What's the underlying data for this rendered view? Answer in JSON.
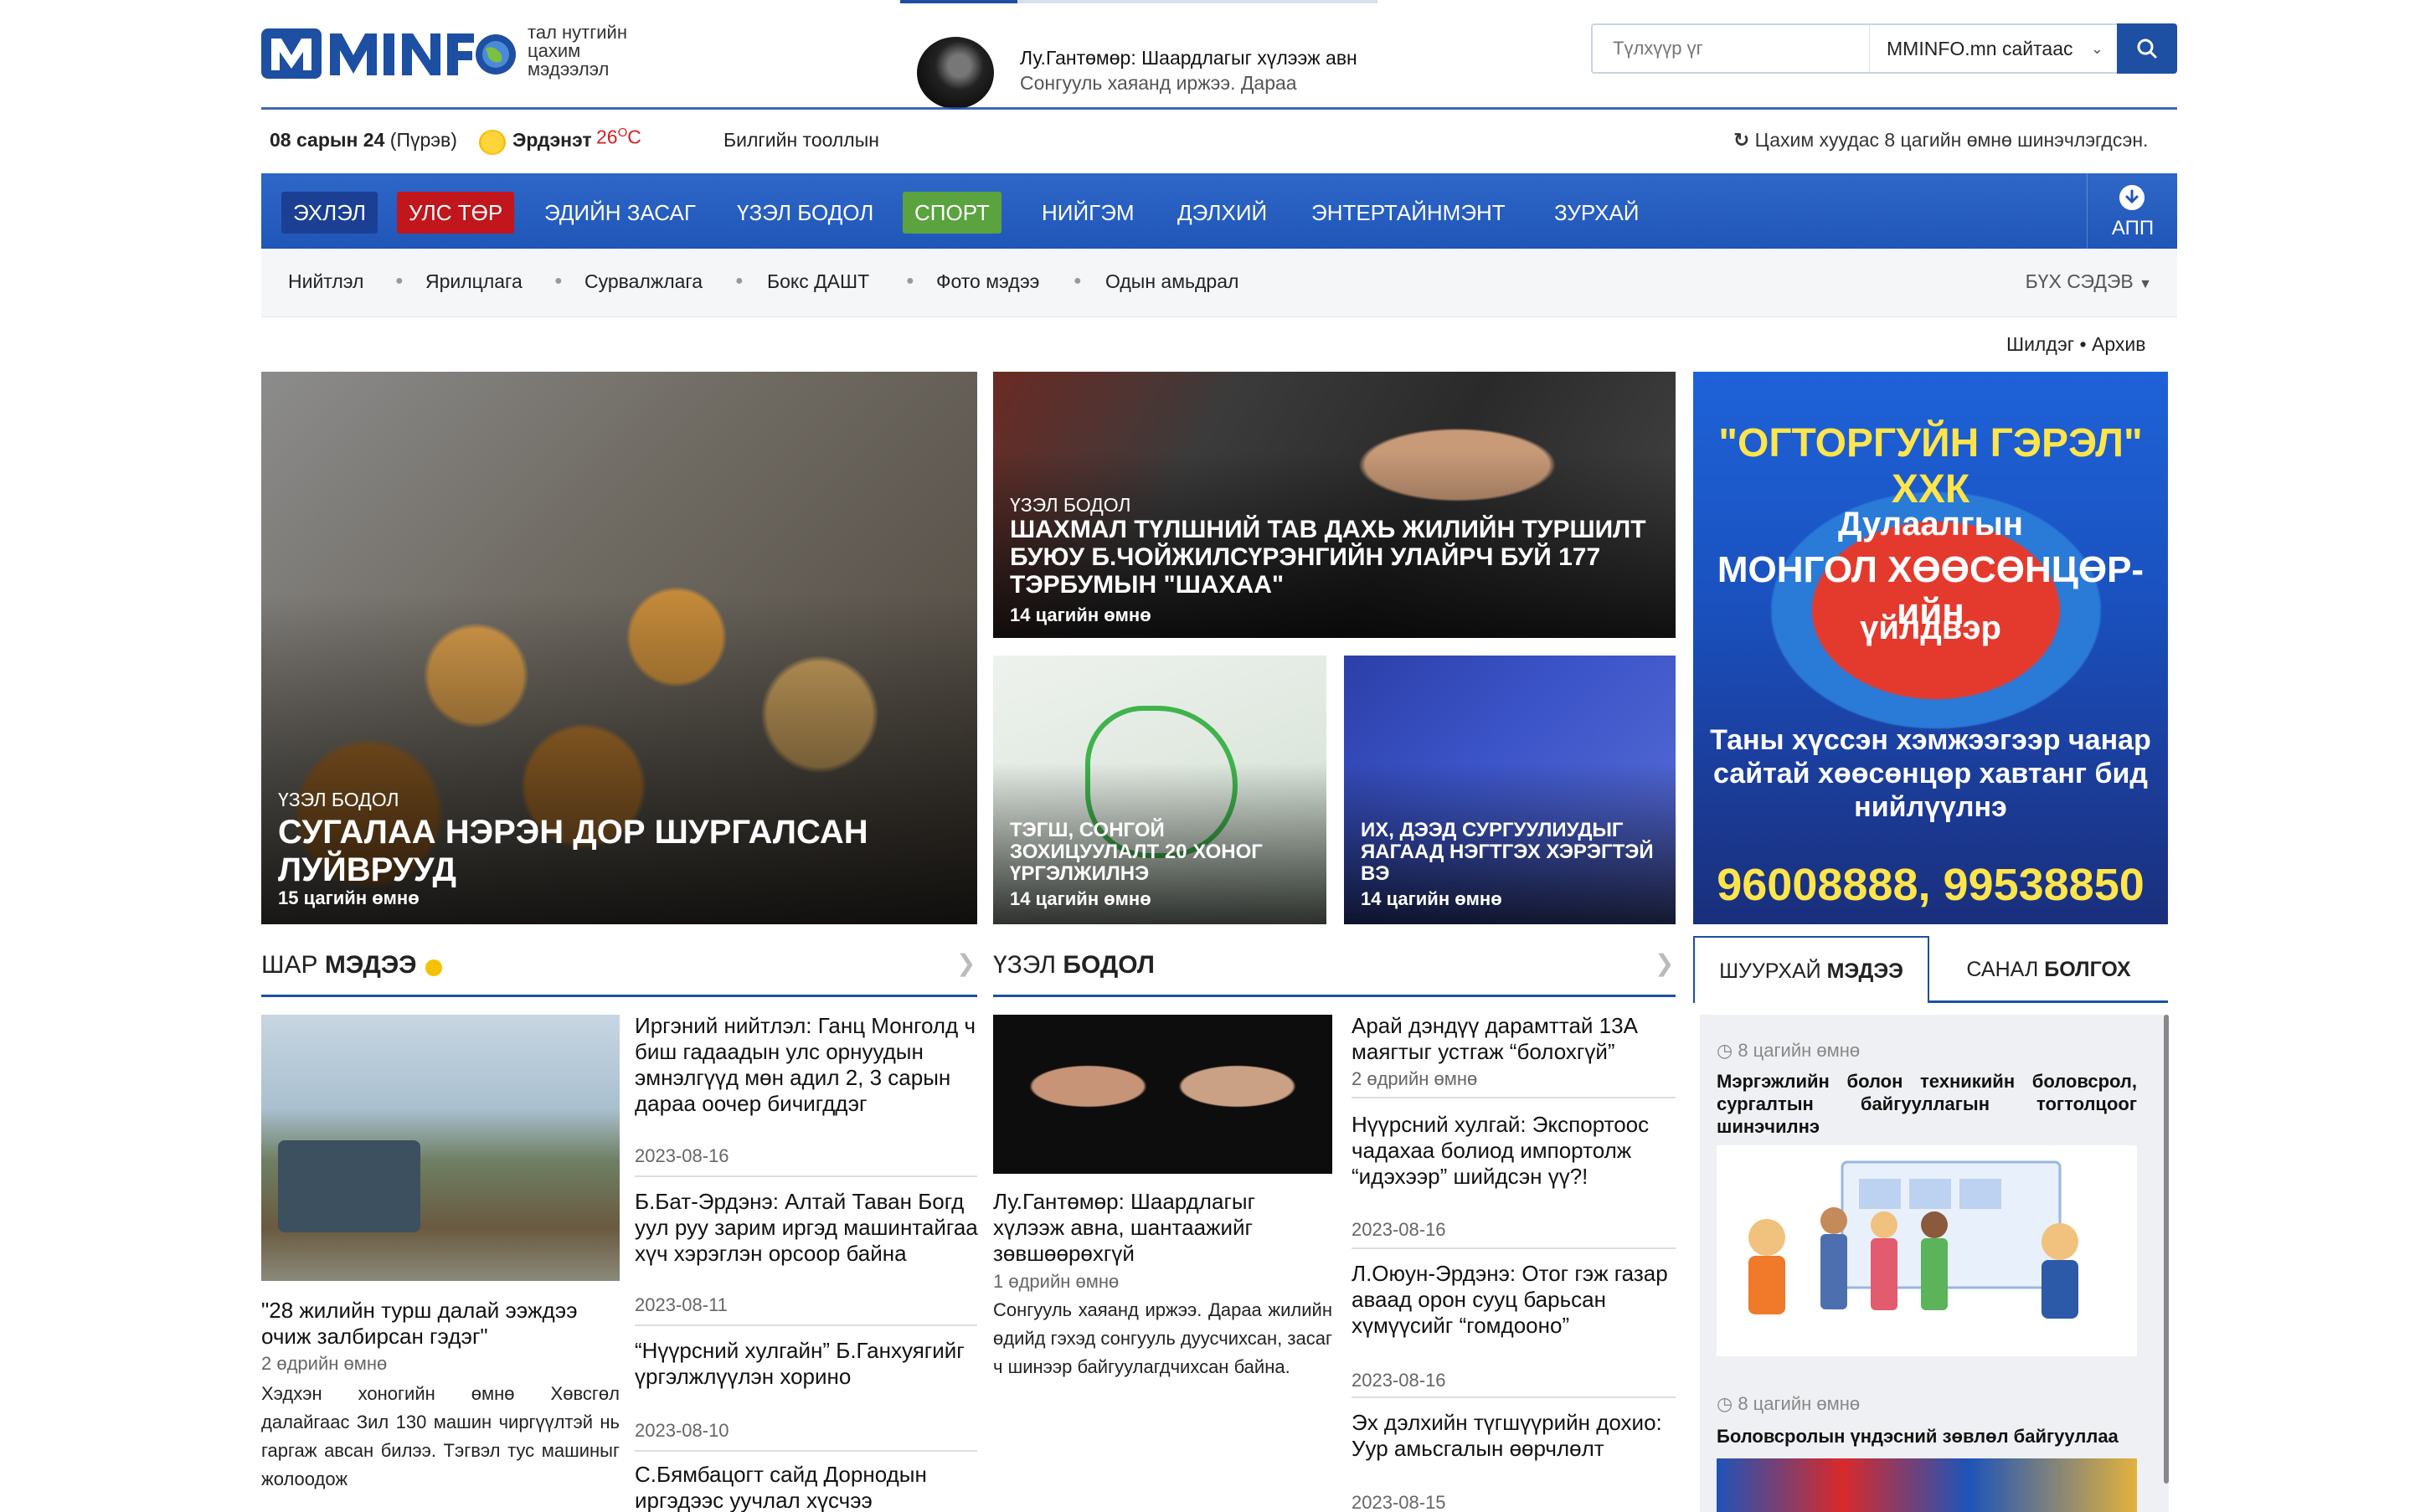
{
  "header": {
    "logo_text": "MMINFO",
    "logo_tagline": [
      "тал нутгийн",
      "цахим",
      "мэдээлэл"
    ],
    "ticker_title": "Лу.Гантөмөр: Шаардлагыг хүлээж авн",
    "ticker_sub": "Сонгууль хаяанд иржээ. Дараа",
    "search": {
      "placeholder": "Түлхүүр үг",
      "scope": "MMINFO.mn сайтаас"
    }
  },
  "infobar": {
    "date_bold": "08 сарын 24",
    "date_day": "(Пүрэв)",
    "weather_city": "Эрдэнэт",
    "weather_temp": "26",
    "weather_unit": "O",
    "weather_c": "C",
    "ticker2": "Билгийн тооллын",
    "updated": "Цахим хуудас 8 цагийн өмнө шинэчлэгдсэн."
  },
  "nav": {
    "items": [
      "ЭХЛЭЛ",
      "УЛС ТӨР",
      "ЭДИЙН ЗАСАГ",
      "ҮЗЭЛ БОДОЛ",
      "СПОРТ",
      "НИЙГЭМ",
      "ДЭЛХИЙ",
      "ЭНТЕРТАЙНМЭНТ",
      "ЗУРХАЙ"
    ],
    "app": "АПП"
  },
  "subnav": {
    "items": [
      "Нийтлэл",
      "Ярилцлага",
      "Сурвалжлага",
      "Бокс ДАШТ",
      "Фото мэдээ",
      "Одын амьдрал"
    ],
    "all": "БҮХ СЭДЭВ"
  },
  "links": {
    "shildeg": "Шилдэг",
    "archive": "Архив"
  },
  "hero": {
    "main": {
      "cat": "ҮЗЭЛ БОДОЛ",
      "title": "СУГАЛАА НЭРЭН ДОР ШУРГАЛСАН ЛУЙВРУУД",
      "ago": "15 цагийн өмнө"
    },
    "second": {
      "cat": "ҮЗЭЛ БОДОЛ",
      "title": "ШАХМАЛ ТҮЛШНИЙ ТАВ ДАХЬ ЖИЛИЙН ТУРШИЛТ БУЮУ Б.ЧОЙЖИЛСҮРЭНГИЙН УЛАЙРЧ БУЙ 177 ТЭРБУМЫН \"ШАХАА\"",
      "ago": "14 цагийн өмнө"
    },
    "third": {
      "title": "ТЭГШ, СОНГОЙ ЗОХИЦУУЛАЛТ 20 ХОНОГ ҮРГЭЛЖИЛНЭ",
      "ago": "14 цагийн өмнө"
    },
    "fourth": {
      "title": "ИХ, ДЭЭД СУРГУУЛИУДЫГ ЯАГААД НЭГТГЭХ ХЭРЭГТЭЙ ВЭ",
      "ago": "14 цагийн өмнө"
    }
  },
  "ad": {
    "l1": "\"ОГТОРГУЙН ГЭРЭЛ\" ХХК",
    "l2": "Дулаалгын",
    "l3": "МОНГОЛ ХӨӨСӨНЦӨР-ийн",
    "l4": "үйлдвэр",
    "l5": "Таны хүссэн хэмжээгээр чанар сайтай хөөсөнцөр хавтанг бид нийлүүлнэ",
    "l6": "96008888, 99538850"
  },
  "shar": {
    "h1": "ШАР",
    "h2": "МЭДЭЭ",
    "main_title": "\"28 жилийн турш далай ээждээ очиж залбирсан гэдэг\"",
    "main_date": "2 өдрийн өмнө",
    "main_lead": "Хэдхэн хоногийн өмнө Хөвсгөл далайгаас Зил 130 машин чиргүүлтэй нь гаргаж авсан билээ. Тэгвэл тус машиныг жолоодож",
    "list": [
      {
        "title": "Иргэний нийтлэл: Ганц Монголд ч биш гадаадын улс орнуудын эмнэлгүүд мөн адил 2, 3 сарын дараа оочер бичигддэг",
        "date": "2023-08-16"
      },
      {
        "title": "Б.Бат-Эрдэнэ: Алтай Таван Богд уул руу зарим иргэд машинтайгаа хүч хэрэглэн орсоор байна",
        "date": "2023-08-11"
      },
      {
        "title": "“Нүүрсний хулгайн” Б.Ганхуягийг үргэлжлүүлэн хорино",
        "date": "2023-08-10"
      },
      {
        "title": "С.Бямбацогт сайд Дорнодын иргэдээс уучлал хүсчээ",
        "date": ""
      }
    ]
  },
  "uzel": {
    "h1": "ҮЗЭЛ",
    "h2": "БОДОЛ",
    "main_title": "Лу.Гантөмөр: Шаардлагыг хүлээж авна, шантаажийг зөвшөөрөхгүй",
    "main_date": "1 өдрийн өмнө",
    "main_lead": "Сонгууль хаяанд иржээ. Дараа жилийн өдийд гэхэд сонгууль дуусчихсан, засаг ч шинээр байгуулагдчихсан байна.",
    "list": [
      {
        "title": "Арай дэндүү дарамттай 13А маягтыг устгаж “болохгүй”",
        "date": "2 өдрийн өмнө"
      },
      {
        "title": "Нүүрсний хулгай: Экспортоос чадахаа болиод импортолж “идэхээр” шийдсэн үү?!",
        "date": "2023-08-16"
      },
      {
        "title": "Л.Оюун-Эрдэнэ: Отог гэж газар аваад орон сууц барьсан хүмүүсийг “гомдооно”",
        "date": "2023-08-16"
      },
      {
        "title": "Эх дэлхийн түгшүүрийн дохио: Уур амьсгалын өөрчлөлт",
        "date": "2023-08-15"
      }
    ]
  },
  "tabs": {
    "a1": "ШУУРХАЙ",
    "a2": "МЭДЭЭ",
    "b1": "САНАЛ",
    "b2": "БОЛГОХ"
  },
  "feed": [
    {
      "time": "8 цагийн өмнө",
      "title": "Мэргэжлийн болон техникийн боловсрол, сургалтын байгууллагын тогтолцоог шинэчилнэ"
    },
    {
      "time": "8 цагийн өмнө",
      "title": "Боловсролын үндэсний зөвлөл байгууллаа"
    }
  ],
  "colors": {
    "brand": "#1d4fa3",
    "nav_active": "#1a3f93",
    "nav_politics": "#c0161c",
    "nav_sport": "#5aa33f",
    "weather_temp": "#d32020"
  }
}
